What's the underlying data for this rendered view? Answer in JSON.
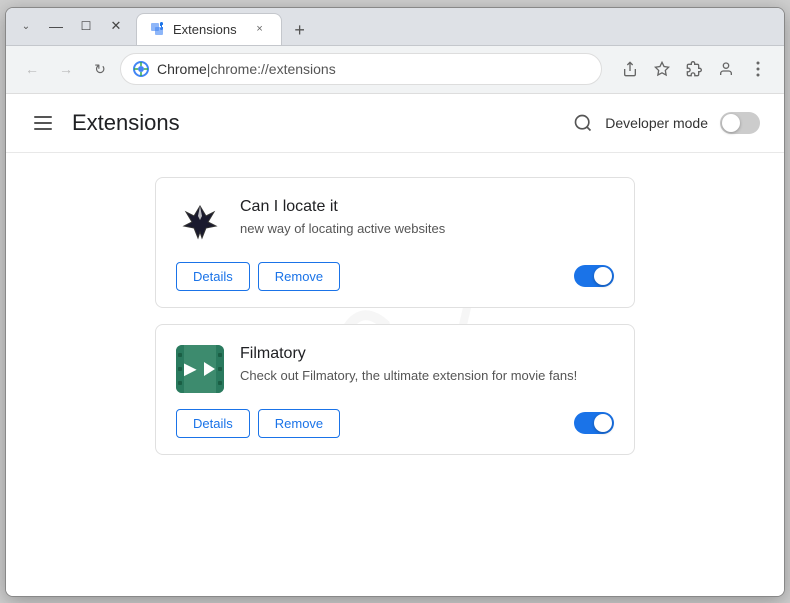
{
  "window": {
    "title": "Extensions"
  },
  "tab": {
    "label": "Extensions",
    "close_label": "×"
  },
  "new_tab_btn": "+",
  "window_controls": {
    "minimize": "—",
    "maximize": "❐",
    "close": "✕",
    "restore": "⌄"
  },
  "address_bar": {
    "back": "←",
    "forward": "→",
    "reload": "↻",
    "origin": "Chrome",
    "separator": "|",
    "path": "chrome://extensions"
  },
  "toolbar_icons": {
    "share": "⬆",
    "star": "☆",
    "extensions": "🧩",
    "profile": "👤",
    "menu": "⋮"
  },
  "extensions_page": {
    "hamburger_label": "Menu",
    "title": "Extensions",
    "search_label": "Search",
    "developer_mode_label": "Developer mode",
    "developer_mode_on": false
  },
  "extensions": [
    {
      "id": "ext1",
      "name": "Can I locate it",
      "description": "new way of locating active websites",
      "details_label": "Details",
      "remove_label": "Remove",
      "enabled": true,
      "logo_type": "bird"
    },
    {
      "id": "ext2",
      "name": "Filmatory",
      "description": "Check out Filmatory, the ultimate extension for movie fans!",
      "details_label": "Details",
      "remove_label": "Remove",
      "enabled": true,
      "logo_type": "film"
    }
  ],
  "watermark": {
    "text": "9/1/..."
  }
}
